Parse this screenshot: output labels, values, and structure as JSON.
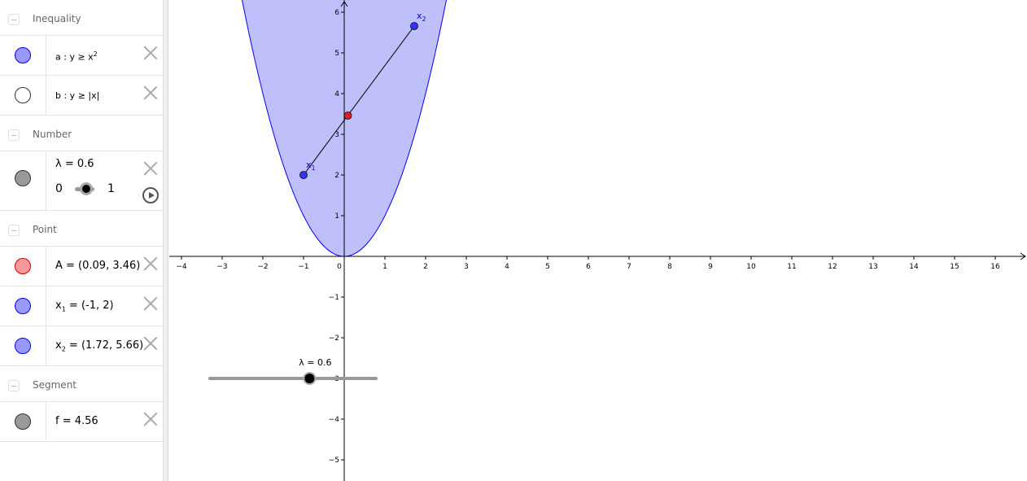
{
  "algebra": {
    "groups": [
      {
        "title": "Inequality",
        "items": [
          {
            "name": "a",
            "text": "a : y ≥ x",
            "sup": "2",
            "color": "#9999ff",
            "shown": true
          },
          {
            "name": "b",
            "text": "b : y ≥ |x|",
            "color": "#ffffff",
            "shown": false
          }
        ]
      },
      {
        "title": "Number",
        "items": [
          {
            "name": "lambda",
            "text": "λ = 0.6",
            "min": "0",
            "max": "1",
            "value": 0.6,
            "color": "#999999"
          }
        ]
      },
      {
        "title": "Point",
        "items": [
          {
            "name": "A",
            "text": "A = (0.09, 3.46)",
            "color": "#f89898"
          },
          {
            "name": "x1",
            "pre": "x",
            "sub": "1",
            "text": " = (-1, 2)",
            "color": "#9999ff"
          },
          {
            "name": "x2",
            "pre": "x",
            "sub": "2",
            "text": " = (1.72, 5.66)",
            "color": "#9999ff"
          }
        ]
      },
      {
        "title": "Segment",
        "items": [
          {
            "name": "f",
            "text": "f = 4.56",
            "color": "#999999"
          }
        ]
      }
    ]
  },
  "graphics": {
    "xlim": [
      -4.3,
      16.8
    ],
    "ylim": [
      -5.5,
      6.3
    ],
    "x_ticks": [
      -4,
      -3,
      -2,
      -1,
      0,
      1,
      2,
      3,
      4,
      5,
      6,
      7,
      8,
      9,
      10,
      11,
      12,
      13,
      14,
      15,
      16
    ],
    "y_ticks": [
      -5,
      -4,
      -3,
      -2,
      -1,
      1,
      2,
      3,
      4,
      5,
      6
    ],
    "region": {
      "label": "a",
      "inequality": "y ≥ x^2",
      "fill": "#bfbffb",
      "stroke": "#0000ff"
    },
    "points": [
      {
        "name": "x1",
        "label": "x",
        "sub": "1",
        "x": -1,
        "y": 2,
        "color": "#3333ff"
      },
      {
        "name": "x2",
        "label": "x",
        "sub": "2",
        "x": 1.72,
        "y": 5.66,
        "color": "#3333ff"
      },
      {
        "name": "A",
        "x": 0.09,
        "y": 3.46,
        "color": "#e02020"
      }
    ],
    "segment": {
      "name": "f",
      "from": [
        -1,
        2
      ],
      "to": [
        1.72,
        5.66
      ]
    },
    "slider": {
      "label": "λ = 0.6",
      "value": 0.6,
      "min": 0,
      "max": 1,
      "from_x": -3.3,
      "to_x": 0.78,
      "y": -3
    }
  }
}
